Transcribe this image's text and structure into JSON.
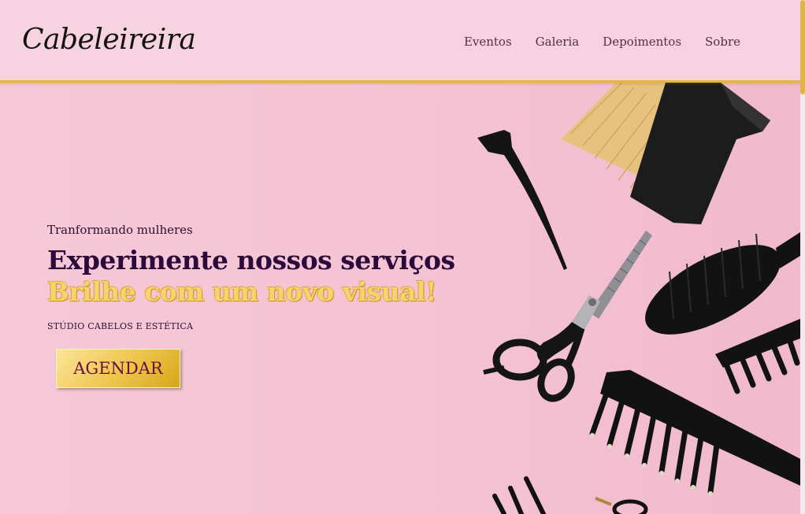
{
  "header": {
    "brand": "Cabeleireira",
    "nav": [
      "Eventos",
      "Galeria",
      "Depoimentos",
      "Sobre"
    ]
  },
  "hero": {
    "eyebrow": "Tranformando mulheres",
    "headline": "Experimente nossos serviços",
    "highlight": "Brilhe com um novo visual!",
    "studio": "STÚDIO CABELOS E ESTÉTICA",
    "cta_label": "AGENDAR"
  },
  "colors": {
    "background": "#f6c9d8",
    "header_bg": "#f7d3e1",
    "gold_accent": "#e7b83a",
    "headline_purple": "#2d0a3c",
    "cta_text": "#6b1040"
  },
  "icons": [
    "hair-brush-icon",
    "hair-clip-icon",
    "scissors-icon",
    "round-brush-icon",
    "comb-icon"
  ]
}
